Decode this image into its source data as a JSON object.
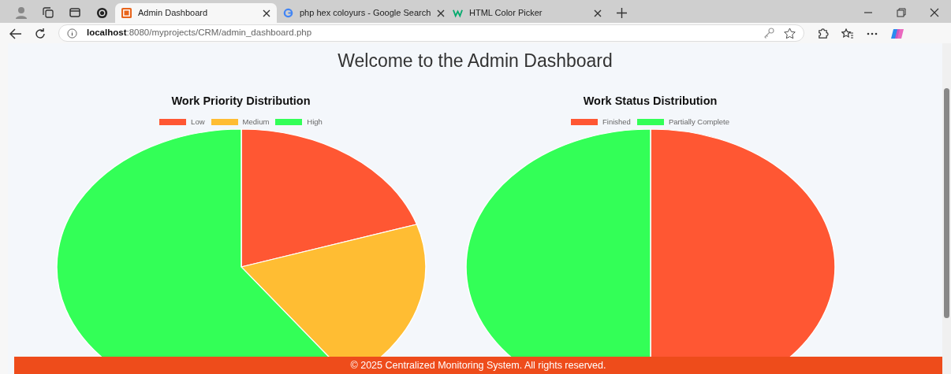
{
  "browser": {
    "tabs": [
      {
        "title": "Admin Dashboard",
        "selected": true
      },
      {
        "title": "php hex coloyurs - Google Search",
        "selected": false
      },
      {
        "title": "HTML Color Picker",
        "selected": false
      }
    ],
    "address": {
      "host": "localhost",
      "path": ":8080/myprojects/CRM/admin_dashboard.php"
    }
  },
  "page": {
    "heading": "Welcome to the Admin Dashboard",
    "charts": [
      {
        "title": "Work Priority Distribution",
        "legend": [
          {
            "label": "Low",
            "color": "#ff5733"
          },
          {
            "label": "Medium",
            "color": "#ffbd33"
          },
          {
            "label": "High",
            "color": "#33ff57"
          }
        ]
      },
      {
        "title": "Work Status Distribution",
        "legend": [
          {
            "label": "Finished",
            "color": "#ff5733"
          },
          {
            "label": "Partially Complete",
            "color": "#33ff57"
          }
        ]
      }
    ],
    "footer": "© 2025 Centralized Monitoring System. All rights reserved."
  }
}
